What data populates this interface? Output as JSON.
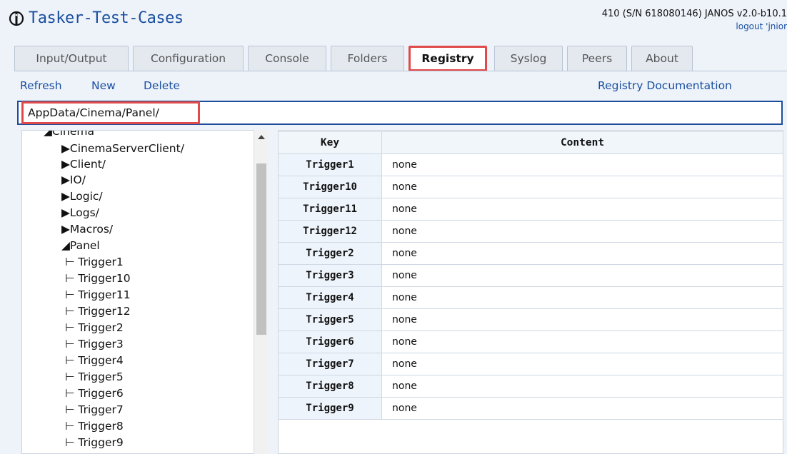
{
  "header": {
    "title": "Tasker-Test-Cases",
    "device_info": "410 (S/N 618080146) JANOS v2.0-b10.1",
    "logout": "logout 'jnior"
  },
  "tabs": [
    {
      "label": "Input/Output",
      "active": false
    },
    {
      "label": "Configuration",
      "active": false
    },
    {
      "label": "Console",
      "active": false
    },
    {
      "label": "Folders",
      "active": false
    },
    {
      "label": "Registry",
      "active": true
    },
    {
      "label": "Syslog",
      "active": false
    },
    {
      "label": "Peers",
      "active": false
    },
    {
      "label": "About",
      "active": false
    }
  ],
  "toolbar": {
    "refresh": "Refresh",
    "new": "New",
    "delete": "Delete",
    "docs": "Registry Documentation"
  },
  "path": {
    "value": "AppData/Cinema/Panel/"
  },
  "tree": {
    "items": [
      {
        "label": "◢Cinema"
      },
      {
        "label": "▶CinemaServerClient/"
      },
      {
        "label": "▶Client/"
      },
      {
        "label": "▶IO/"
      },
      {
        "label": "▶Logic/"
      },
      {
        "label": "▶Logs/"
      },
      {
        "label": "▶Macros/"
      },
      {
        "label": "◢Panel"
      },
      {
        "label": "⊢ Trigger1"
      },
      {
        "label": "⊢ Trigger10"
      },
      {
        "label": "⊢ Trigger11"
      },
      {
        "label": "⊢ Trigger12"
      },
      {
        "label": "⊢ Trigger2"
      },
      {
        "label": "⊢ Trigger3"
      },
      {
        "label": "⊢ Trigger4"
      },
      {
        "label": "⊢ Trigger5"
      },
      {
        "label": "⊢ Trigger6"
      },
      {
        "label": "⊢ Trigger7"
      },
      {
        "label": "⊢ Trigger8"
      },
      {
        "label": "⊢ Trigger9"
      }
    ]
  },
  "table": {
    "headers": {
      "key": "Key",
      "content": "Content"
    },
    "rows": [
      {
        "key": "Trigger1",
        "content": "none"
      },
      {
        "key": "Trigger10",
        "content": "none"
      },
      {
        "key": "Trigger11",
        "content": "none"
      },
      {
        "key": "Trigger12",
        "content": "none"
      },
      {
        "key": "Trigger2",
        "content": "none"
      },
      {
        "key": "Trigger3",
        "content": "none"
      },
      {
        "key": "Trigger4",
        "content": "none"
      },
      {
        "key": "Trigger5",
        "content": "none"
      },
      {
        "key": "Trigger6",
        "content": "none"
      },
      {
        "key": "Trigger7",
        "content": "none"
      },
      {
        "key": "Trigger8",
        "content": "none"
      },
      {
        "key": "Trigger9",
        "content": "none"
      }
    ]
  },
  "colors": {
    "accent": "#1a4fa0",
    "highlight": "#e04a4a",
    "background": "#eef3fa"
  }
}
